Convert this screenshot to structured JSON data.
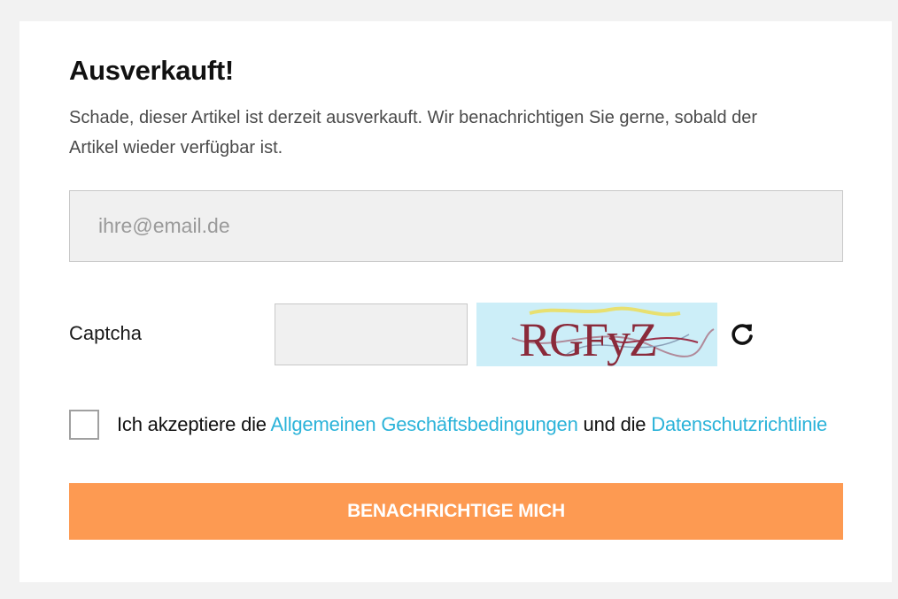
{
  "notify_form": {
    "title": "Ausverkauft!",
    "description": "Schade, dieser Artikel ist derzeit ausverkauft. Wir benachrichtigen Sie gerne, sobald der Artikel wieder verfügbar ist.",
    "email_placeholder": "ihre@email.de",
    "email_value": "",
    "captcha_label": "Captcha",
    "captcha_value": "",
    "captcha_image_text": "RGFyZ",
    "refresh_icon": "refresh-icon",
    "consent_prefix": "Ich akzeptiere die",
    "terms_link": "Allgemeinen Geschäftsbedingungen",
    "consent_middle": "und die",
    "privacy_link": "Datenschutzrichtlinie",
    "consent_checked": false,
    "submit_label": "BENACHRICHTIGE MICH"
  },
  "colors": {
    "accent_button": "#fd9a52",
    "link": "#2bb3d9",
    "captcha_background": "#cceef8"
  }
}
